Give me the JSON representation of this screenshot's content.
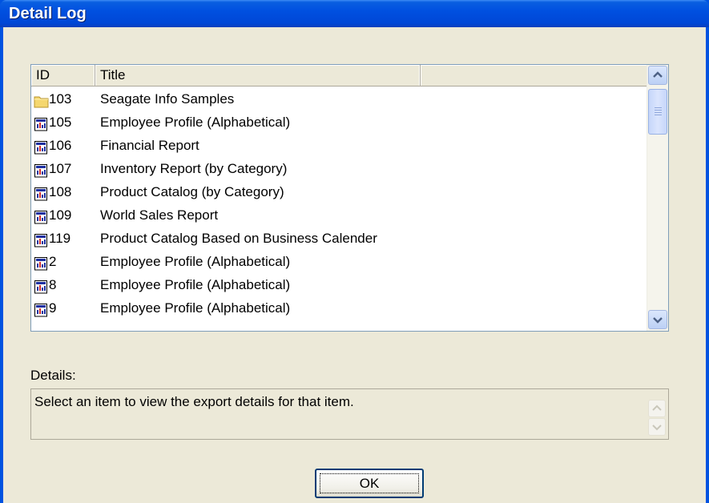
{
  "window": {
    "title": "Detail Log"
  },
  "list": {
    "columns": [
      "ID",
      "Title",
      ""
    ],
    "rows": [
      {
        "id": "103",
        "title": "Seagate Info Samples",
        "icon": "folder-icon"
      },
      {
        "id": "105",
        "title": "Employee Profile (Alphabetical)",
        "icon": "report-icon"
      },
      {
        "id": "106",
        "title": "Financial Report",
        "icon": "report-icon"
      },
      {
        "id": "107",
        "title": "Inventory Report (by Category)",
        "icon": "report-icon"
      },
      {
        "id": "108",
        "title": "Product Catalog (by Category)",
        "icon": "report-icon"
      },
      {
        "id": "109",
        "title": "World Sales Report",
        "icon": "report-icon"
      },
      {
        "id": "119",
        "title": "Product Catalog Based on Business Calender",
        "icon": "report-icon"
      },
      {
        "id": "2",
        "title": "Employee Profile (Alphabetical)",
        "icon": "report-icon"
      },
      {
        "id": "8",
        "title": "Employee Profile (Alphabetical)",
        "icon": "report-icon"
      },
      {
        "id": "9",
        "title": "Employee Profile (Alphabetical)",
        "icon": "report-icon"
      }
    ]
  },
  "details": {
    "label": "Details:",
    "text": "Select an item to view the export details for that item."
  },
  "buttons": {
    "ok": "OK"
  },
  "colors": {
    "titlebar": "#0050e0",
    "dialog_bg": "#ece9d8",
    "list_border": "#7f9db9"
  }
}
